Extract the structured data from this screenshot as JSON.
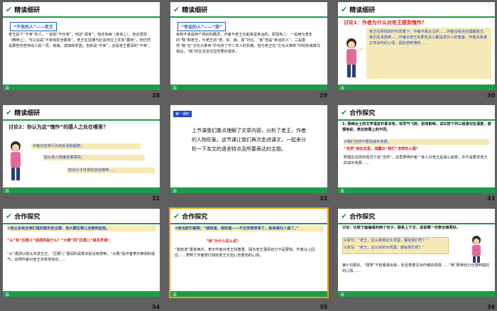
{
  "slides": [
    {
      "num": "28",
      "title": "精读细研",
      "tag": "“不幸的人”——老王",
      "body": "老王是个“不幸”的人，一是他“不仅老”，他还“孤身”，他还有病（身体上），他还很穷（精神上），可以说是“不幸有的全都有”。老王在狂潮与社会地位上并未“翻身”，他仍然是那些穷苦劳动人民一员，疾病，孤独和穷困，也就是“不幸”，这是老王更深的“不幸”。"
    },
    {
      "num": "29",
      "title": "精读细研",
      "tag": "“幸运的人”——“我”",
      "body": "幸和不幸是两个相对的概念，作者与老王比起来是幸运的。原因有二：一是两为老年的“我”和老王，与老王的“老、贫、病、孤”对比，“我”自是“幸运的人”；二是虽然“我”在“文化大革命”中也受了不少非人的折磨，但与老王在“文化大革命”中的贫病境况相比，“我”的生活状况显然要好很多。"
    },
    {
      "num": "30",
      "title": "精读细研",
      "q": "讨论1：作者为什么对老王感到愧怍？",
      "a": "老王在那样的时代背景下，作者不敢太过问……作者没有完全理解老王，我们后来想到……作者对老王的那些关心都是局外人的角度，作者没有真正体会他的心情，因此感到愧疚……"
    },
    {
      "num": "31",
      "title": "精读细研",
      "q": "讨论2：你认为这“愧怍”的感人之处在哪里？",
      "notes": [
        "作者对自身行为的反省和解剖；",
        "能从他人角度考量事情；",
        "知识分子可贵的自省精神……"
      ]
    },
    {
      "num": "32",
      "tag": "第一课时",
      "body": "上节课我们重点理解了文章内容，分析了老王，作者的人物形象。这节课让我们再次走进课文，一起来分析一下本文的语言特点及所要表达的主题。"
    },
    {
      "num": "33",
      "title": "合作探究",
      "q": "1. 杨绛女士的文学语言朴素本色，却灵气飞扬，别有韵味，试比较下列三组语句在语意，感情色彩，表达效果上的不同。",
      "sub": "①我们当然不要他减半收费。",
      "quote": "“当然”用在这里，流露出“我们”怎样的心理？",
      "body": "照理在这样的情况下说“当然”，这里表明作者一家人对老王是诚心诚意，并不是要求老王的减半收费……"
    },
    {
      "num": "34",
      "title": "合作探究",
      "q": "②他从没有还我们是好欺负的主顾，他大概压根儿没想到这些。",
      "quote": "“从”和“压根儿”强调的是什么？“大概”同“压根儿”是否矛盾？",
      "body": "“从”强调以前从未发生过，“压根儿”强调的是根本就没有想到。“大概”是作者表示推测的语气，说明作者对老王非常地信任……"
    },
    {
      "num": "35",
      "title": "合作探究",
      "q": "③我也赶忙解释：“我知道，我知道——不过你既然来了，就免得托人捎了。”",
      "quote": "“我”为什么这么说？",
      "body": "“我知道”重复两次，表示作者对老王的尊重，因为老王强调自己不是要钱，作者马上回应……表明了作者想付钱给老王又担心伤害他的心情。"
    },
    {
      "num": "36",
      "title": "合作探究",
      "q": "讨论：比较下面每组的两个句子，联系上下文，说说哪一句表达得更好。",
      "opt1": "①原句：“老王，这么新鲜的大鸡蛋，都给我们吃？”",
      "opt2": "②改写：“老王，这么好的大鸡蛋，都给我们吃？”",
      "body": "第①句更好。“强笑”不但看得出来，而且着重写出作者的情感……“我”那种自己也感到尴尬的心情……"
    }
  ]
}
